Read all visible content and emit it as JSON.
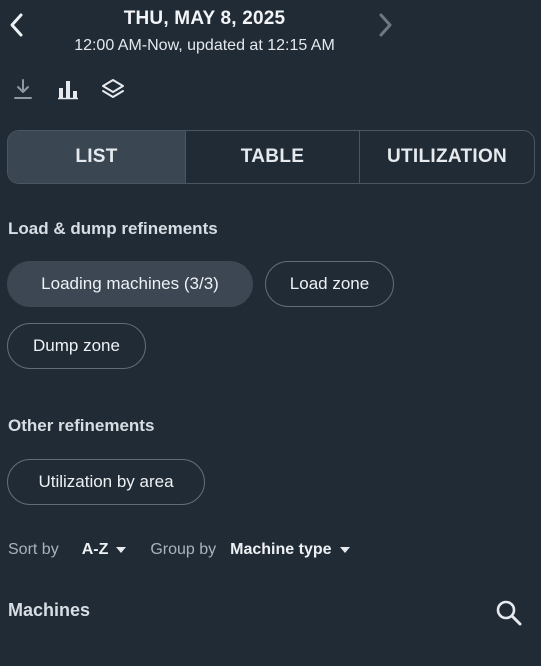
{
  "header": {
    "title": "THU, MAY 8, 2025",
    "subtitle": "12:00 AM-Now, updated at 12:15 AM",
    "prev_icon": "chevron-left-icon",
    "next_icon": "chevron-right-icon"
  },
  "toolbar": {
    "icons": [
      "download-icon",
      "bar-chart-icon",
      "layers-icon"
    ]
  },
  "view_tabs": {
    "selected": "LIST",
    "items": [
      "LIST",
      "TABLE",
      "UTILIZATION"
    ]
  },
  "load_dump": {
    "title": "Load & dump refinements",
    "chips": [
      "Loading machines (3/3)",
      "Load zone",
      "Dump zone"
    ]
  },
  "other": {
    "title": "Other refinements",
    "chips": [
      "Utilization by area"
    ]
  },
  "sort": {
    "sort_label": "Sort by",
    "sort_value": "A-Z",
    "group_label": "Group by",
    "group_value": "Machine type"
  },
  "machines": {
    "title": "Machines",
    "search_icon": "search-icon"
  },
  "colors": {
    "background": "#212b35",
    "selected_tab": "#3a4652",
    "chip_filled": "#3c4753",
    "border": "#606c78"
  }
}
